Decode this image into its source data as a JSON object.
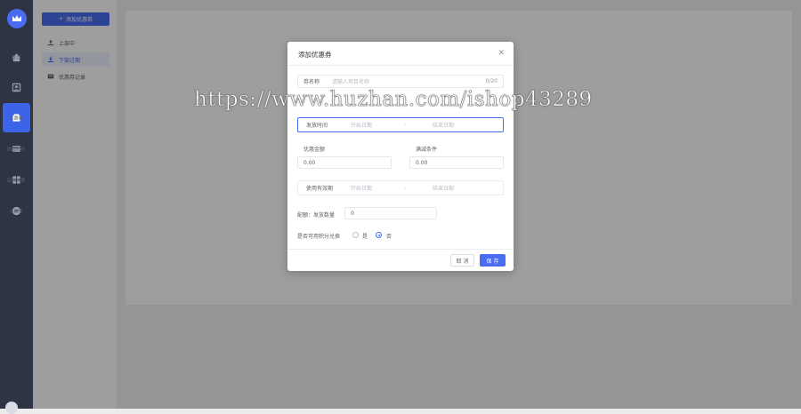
{
  "sidebar": {
    "items": [
      {
        "label": "首页",
        "icon": "home-icon"
      },
      {
        "label": "会员",
        "icon": "member-icon"
      },
      {
        "label": "优惠券",
        "icon": "coupon-icon",
        "active": true
      },
      {
        "label": "储值购卡",
        "icon": "card-icon"
      },
      {
        "label": "店铺设置",
        "icon": "store-settings-icon"
      },
      {
        "label": "小程序",
        "icon": "mini-program-icon"
      }
    ]
  },
  "submenu": {
    "add_button": "添加优惠券",
    "items": [
      {
        "label": "上架中",
        "icon": "upload-icon"
      },
      {
        "label": "下架过期",
        "icon": "download-icon",
        "active": true
      },
      {
        "label": "优惠券记录",
        "icon": "record-icon"
      }
    ]
  },
  "dialog": {
    "title": "添加优惠券",
    "name_label": "券名称",
    "name_placeholder": "请输入项目名称",
    "name_count": "0/20",
    "issue_label": "发放时间",
    "issue_start": "开始日期",
    "issue_sep": "-",
    "issue_end": "结束日期",
    "amount_label": "优惠金额",
    "amount_value": "0.00",
    "threshold_label": "满减条件",
    "threshold_value": "0.00",
    "use_label": "使用有效期",
    "use_start": "开始日期",
    "use_sep": "-",
    "use_end": "结束日期",
    "gift_label": "配额：发放数量",
    "gift_value": "0",
    "points_label": "是否可用积分兑换",
    "yes_label": "是",
    "no_label": "否",
    "points_selected": "否",
    "cancel_label": "取 消",
    "save_label": "保 存"
  },
  "watermark": "https://www.huzhan.com/ishop43289",
  "colors": {
    "accent": "#4a6cf0",
    "rail": "#2e3444"
  }
}
